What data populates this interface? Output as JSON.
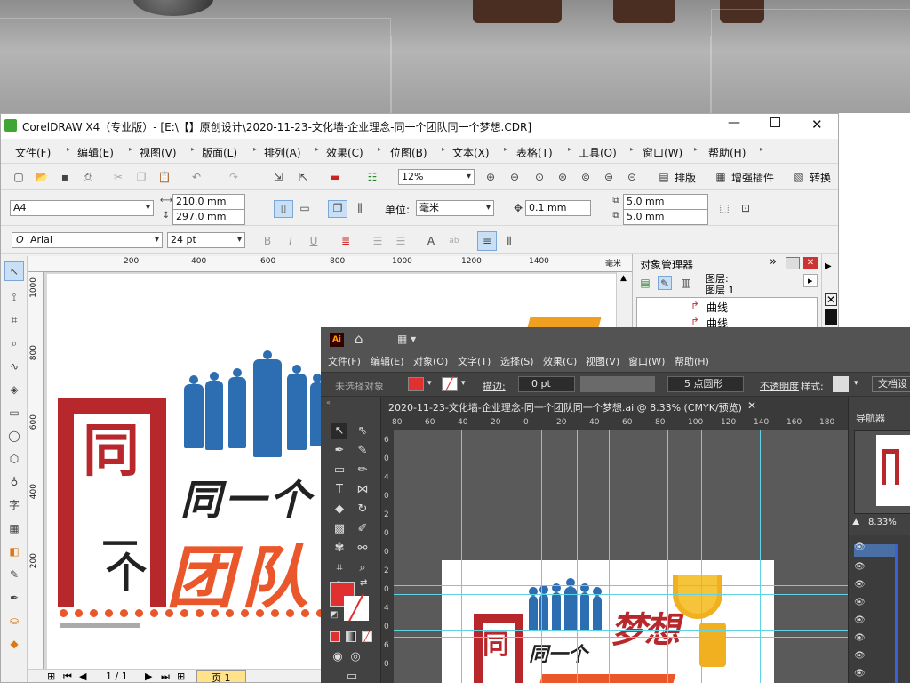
{
  "corel": {
    "title": "CorelDRAW X4（专业版）- [E:\\【】原创设计\\2020-11-23-文化墙-企业理念-同一个团队同一个梦想.CDR]",
    "menu": [
      "文件(F)",
      "编辑(E)",
      "视图(V)",
      "版面(L)",
      "排列(A)",
      "效果(C)",
      "位图(B)",
      "文本(X)",
      "表格(T)",
      "工具(O)",
      "窗口(W)",
      "帮助(H)"
    ],
    "toolbar": {
      "zoom": "12%",
      "layout": "排版",
      "enhance": "增强插件",
      "convert": "转换"
    },
    "property": {
      "page_size": "A4",
      "width": "210.0 mm",
      "height": "297.0 mm",
      "unit_label": "单位:",
      "unit": "毫米",
      "nudge": "0.1 mm",
      "dup_x": "5.0 mm",
      "dup_y": "5.0 mm"
    },
    "text_bar": {
      "font": "Arial",
      "size": "24 pt"
    },
    "ruler": {
      "ticks": [
        "200",
        "400",
        "600",
        "800",
        "1000",
        "1200",
        "1400"
      ],
      "unit": "毫米",
      "vticks": [
        "1000",
        "800",
        "600",
        "400",
        "200"
      ]
    },
    "object_manager": {
      "title": "对象管理器",
      "layer_a": "图层:",
      "layer_b": "图层 1",
      "curve1": "曲线",
      "curve2": "曲线"
    },
    "status": {
      "page_count": "1 / 1",
      "page_tab": "页 1"
    }
  },
  "artwork": {
    "big_char": "同",
    "line1": "同一个",
    "line2_a": "一",
    "line2_b": "个",
    "line2_c": "团队"
  },
  "ai": {
    "logo": "Ai",
    "menu": [
      "文件(F)",
      "编辑(E)",
      "对象(O)",
      "文字(T)",
      "选择(S)",
      "效果(C)",
      "视图(V)",
      "窗口(W)",
      "帮助(H)"
    ],
    "control": {
      "no_selection": "未选择对象",
      "stroke_label": "描边:",
      "stroke_value": "0 pt",
      "brush": "5 点圆形",
      "opacity_label": "不透明度",
      "style_label": "样式:",
      "doc_settings": "文档设"
    },
    "tab_title": "2020-11-23-文化墙-企业理念-同一个团队同一个梦想.ai @ 8.33% (CMYK/预览)",
    "ruler_ticks": [
      "80",
      "60",
      "40",
      "20",
      "0",
      "20",
      "40",
      "60",
      "80",
      "100",
      "120",
      "140",
      "160",
      "180"
    ],
    "vruler_ticks": [
      "6",
      "0",
      "4",
      "0",
      "2",
      "0",
      "0",
      "2",
      "0",
      "4",
      "0",
      "6",
      "0"
    ],
    "navigator": {
      "title": "导航器",
      "zoom": "8.33%"
    },
    "artboard": {
      "line1": "同一个",
      "dream": "梦想",
      "big_char": "同"
    }
  },
  "colors": {
    "red": "#b8272b",
    "orange": "#e9572a",
    "blue": "#2c6eb1",
    "ai_bg": "#535353",
    "ai_panel": "#3c3c3c",
    "guide": "#5fd3e2"
  }
}
